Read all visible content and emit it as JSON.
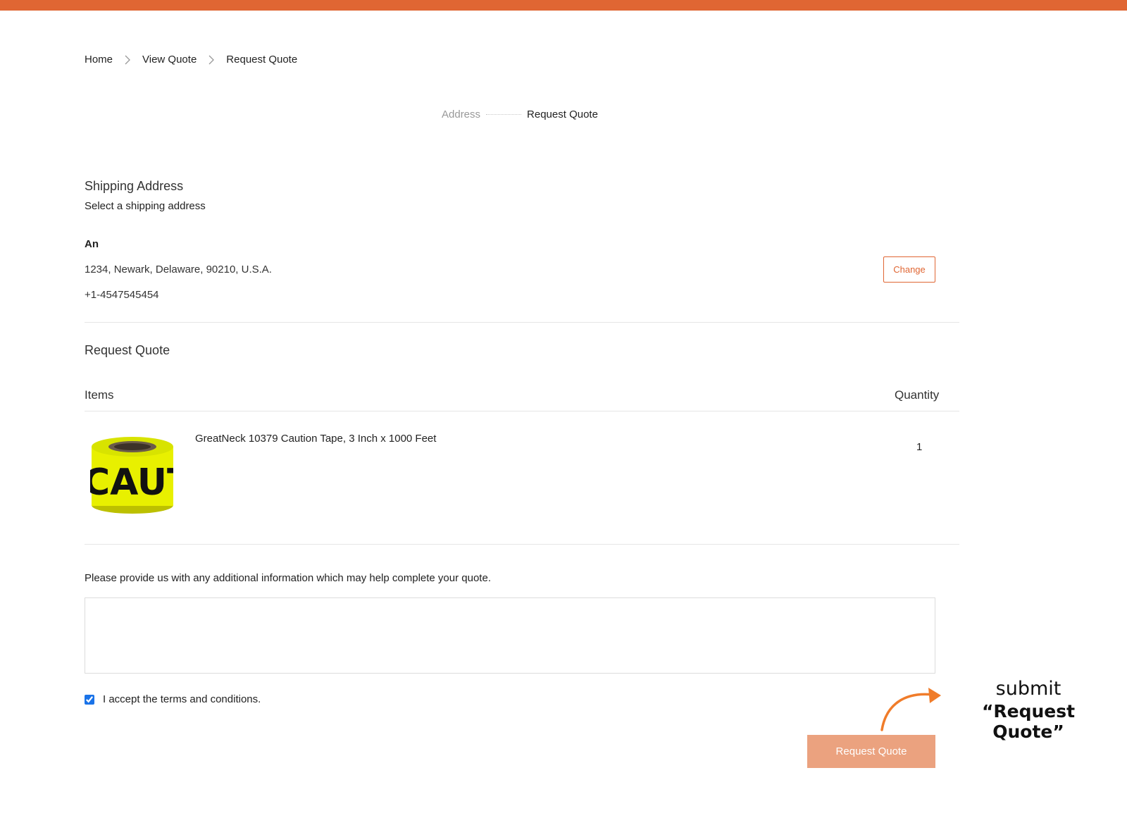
{
  "colors": {
    "accent": "#e06633",
    "button_fill": "#eba27f",
    "arrow": "#f07c2a"
  },
  "breadcrumb": {
    "items": [
      "Home",
      "View Quote"
    ],
    "current": "Request Quote"
  },
  "steps": {
    "step1": "Address",
    "step2": "Request Quote"
  },
  "shipping": {
    "title": "Shipping Address",
    "subtitle": "Select a shipping address",
    "name": "An",
    "address": "1234,  Newark,  Delaware,  90210, U.S.A.",
    "phone": "+1-4547545454",
    "change_label": "Change"
  },
  "quote": {
    "title": "Request Quote",
    "col_items": "Items",
    "col_quantity": "Quantity",
    "items": [
      {
        "name": "GreatNeck 10379 Caution Tape, 3 Inch x 1000 Feet",
        "quantity": "1",
        "image_text": "CAUT",
        "icon": "caution-tape-image"
      }
    ]
  },
  "additional_info": {
    "label": "Please provide us with any additional information which may help complete your quote.",
    "value": "",
    "placeholder": ""
  },
  "terms": {
    "label": "I accept the terms and conditions.",
    "checked": true
  },
  "submit_label": "Request Quote",
  "annotation": {
    "line1": "submit",
    "line2": "“Request Quote”"
  }
}
